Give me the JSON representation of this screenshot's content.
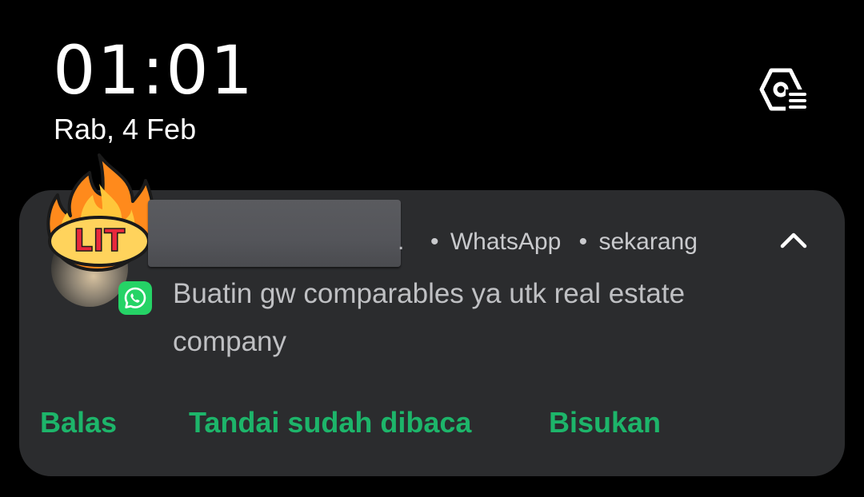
{
  "lockscreen": {
    "time": "01:01",
    "date": "Rab, 4 Feb",
    "settings_icon": "notification-settings-icon"
  },
  "notification": {
    "name_tail": ".",
    "app": "WhatsApp",
    "time": "sekarang",
    "dot": "•",
    "message": "Buatin gw comparables ya utk real estate company",
    "avatar_sticker_text": "LIT",
    "app_badge_icon": "whatsapp-icon",
    "expand_icon": "chevron-up-icon",
    "actions": {
      "reply": "Balas",
      "mark_read": "Tandai sudah dibaca",
      "mute": "Bisukan"
    },
    "colors": {
      "card_bg": "#2b2c2e",
      "action": "#1db56a",
      "badge": "#25d366"
    }
  }
}
